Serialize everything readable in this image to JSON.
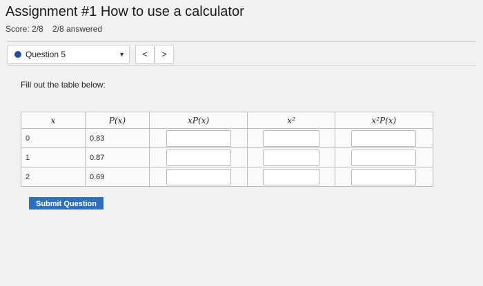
{
  "header": {
    "title": "Assignment #1 How to use a calculator",
    "score": "Score: 2/8",
    "answered": "2/8 answered"
  },
  "question_nav": {
    "current": "Question 5",
    "prev": "<",
    "next": ">"
  },
  "prompt": "Fill out the table below:",
  "table": {
    "headers": [
      "x",
      "P(x)",
      "xP(x)",
      "x²",
      "x²P(x)"
    ],
    "rows": [
      {
        "x": "0",
        "p": "0.83"
      },
      {
        "x": "1",
        "p": "0.87"
      },
      {
        "x": "2",
        "p": "0.69"
      }
    ]
  },
  "submit_label": "Submit Question",
  "colors": {
    "accent": "#2f6fbf",
    "dot": "#1f4fa6"
  }
}
